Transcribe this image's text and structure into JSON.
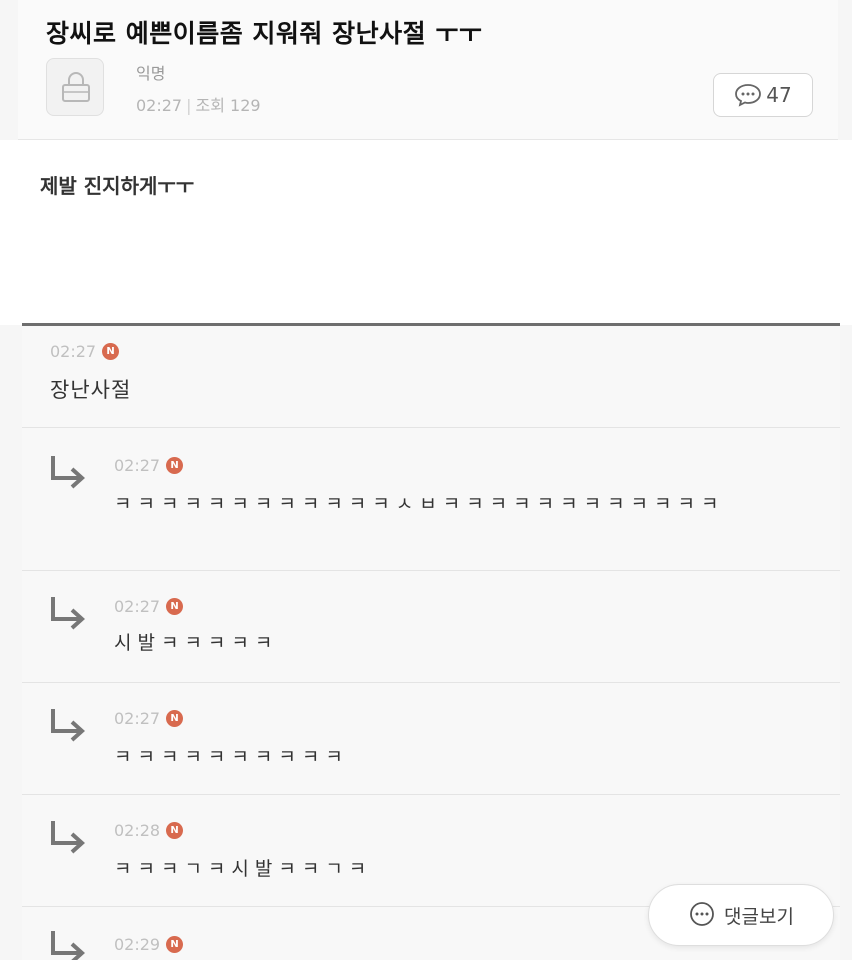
{
  "post": {
    "title": "장씨로 예쁜이름좀 지워줘 장난사절 ㅜㅜ",
    "author": "익명",
    "time": "02:27",
    "views_label": "조회 129",
    "comment_count": "47",
    "body": "제발 진지하게ㅜㅜ"
  },
  "comments": [
    {
      "time": "02:27",
      "badge": "N",
      "text": "장난사절"
    },
    {
      "time": "02:27",
      "badge": "N",
      "text": "ㅋㅋㅋㅋㅋㅋㅋㅋㅋㅋㅋㅋㅅㅂㅋㅋㅋㅋㅋㅋㅋㅋㅋㅋㅋㅋ"
    },
    {
      "time": "02:27",
      "badge": "N",
      "text": "시발ㅋㅋㅋㅋㅋ"
    },
    {
      "time": "02:27",
      "badge": "N",
      "text": "ㅋㅋㅋㅋㅋㅋㅋㅋㅋㅋ"
    },
    {
      "time": "02:28",
      "badge": "N",
      "text": "ㅋㅋㅋㄱㅋ시발ㅋㅋㄱㅋ"
    },
    {
      "time": "02:29",
      "badge": "N",
      "text": ""
    }
  ],
  "view_comments_label": "댓글보기"
}
